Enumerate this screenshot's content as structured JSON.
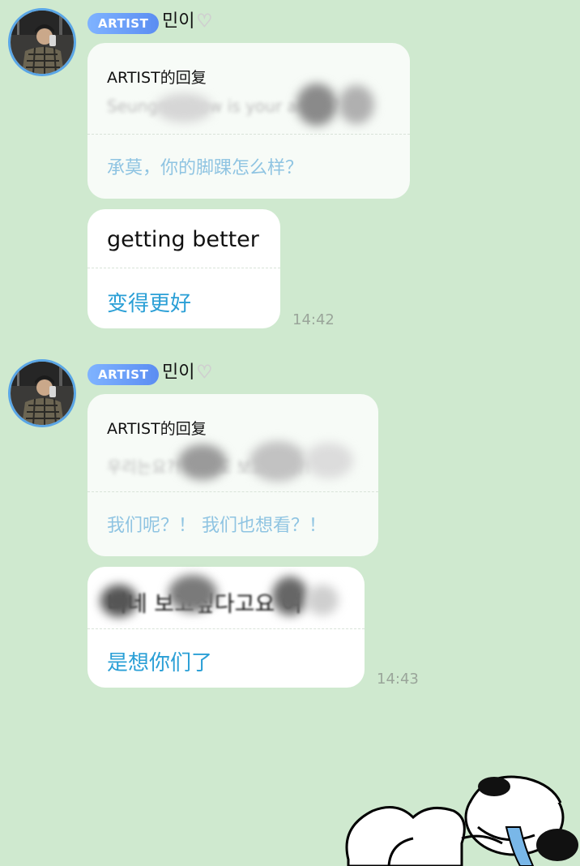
{
  "messages": [
    {
      "badge": "ARTIST",
      "nickname": "민이",
      "heart": "🤍",
      "reply_card": {
        "label": "ARTIST的回复",
        "original_blurred": "Seungmo how is your ankle?",
        "translation": "承莫，你的脚踝怎么样？"
      },
      "reply_text": "getting better",
      "reply_translation": "变得更好",
      "time": "14:42"
    },
    {
      "badge": "ARTIST",
      "nickname": "민이",
      "heart": "🤍",
      "reply_card": {
        "label": "ARTIST的回复",
        "original_blurred": "우리는요?! 우리도 보고싶어?!",
        "translation": "我们呢？！ 我们也想看？！"
      },
      "reply_text": "너네 보고싶다고요 여",
      "reply_translation": "是想你们了",
      "time": "14:43"
    }
  ],
  "colors": {
    "background": "#cfe9cf",
    "badge": "#6a9cf5",
    "translation": "#2a9fd6",
    "avatar_ring": "#5aa6e6"
  },
  "icons": [
    "avatar-photo",
    "heart-icon",
    "snoopy-sticker"
  ]
}
